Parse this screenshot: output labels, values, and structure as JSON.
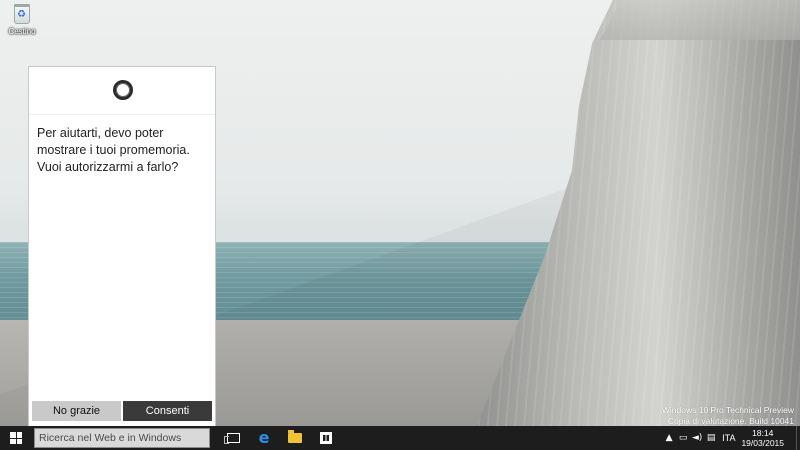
{
  "desktop": {
    "icons": [
      {
        "label": "Cestino",
        "icon": "recycle-bin-icon"
      }
    ]
  },
  "cortana": {
    "icon": "cortana-ring-icon",
    "message": "Per aiutarti, devo poter mostrare i tuoi promemoria. Vuoi autorizzarmi a farlo?",
    "buttons": {
      "decline": "No grazie",
      "accept": "Consenti"
    }
  },
  "watermark": {
    "line1": "Windows 10 Pro Technical Preview",
    "line2": "Copia di valutazione. Build 10041"
  },
  "taskbar": {
    "start_icon": "windows-logo-icon",
    "search_placeholder": "Ricerca nel Web e in Windows",
    "apps": [
      {
        "name": "task-view",
        "icon": "task-view-icon"
      },
      {
        "name": "internet-explorer",
        "icon": "internet-explorer-icon"
      },
      {
        "name": "file-explorer",
        "icon": "folder-icon"
      },
      {
        "name": "store",
        "icon": "store-icon"
      }
    ],
    "tray": {
      "icons": [
        "chevron-up-icon",
        "network-icon",
        "volume-icon",
        "action-center-icon"
      ],
      "language": "ITA",
      "time": "18:14",
      "date": "19/03/2015"
    }
  },
  "colors": {
    "taskbar_bg": "#1d1d1d",
    "accent_button": "#3a3a3a",
    "secondary_button": "#c9c9c9"
  }
}
